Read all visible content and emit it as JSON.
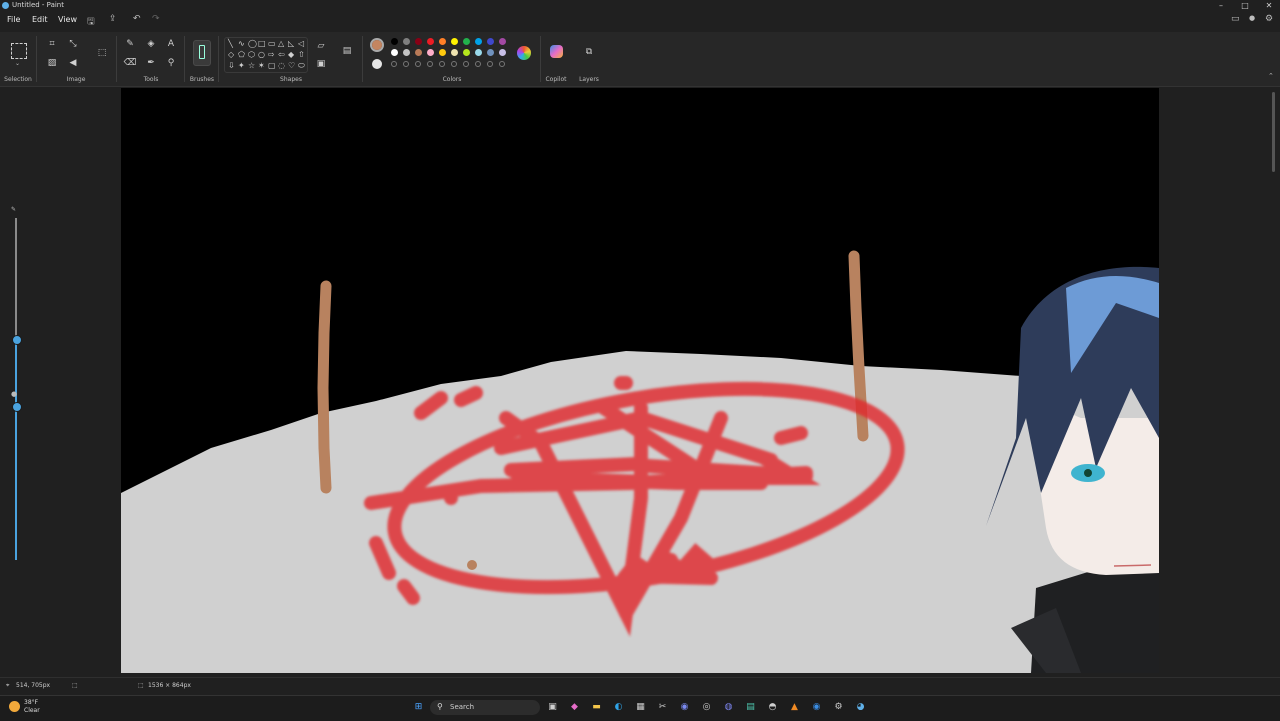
{
  "app": {
    "title": "Untitled - Paint"
  },
  "window_controls": {
    "minimize": "–",
    "maximize": "□",
    "close": "✕"
  },
  "menu": {
    "file": "File",
    "edit": "Edit",
    "view": "View"
  },
  "ribbon": {
    "groups": {
      "selection": "Selection",
      "image": "Image",
      "tools": "Tools",
      "brushes": "Brushes",
      "shapes": "Shapes",
      "colors": "Colors",
      "copilot": "Copilot",
      "layers": "Layers"
    },
    "shape_glyphs": [
      "╲",
      "∿",
      "◯",
      "□",
      "▭",
      "△",
      "◺",
      "◁",
      "◇",
      "⬠",
      "⬡",
      "○",
      "⇨",
      "⇦",
      "◆",
      "⇧",
      "⇩",
      "✦",
      "☆",
      "✶",
      "▢",
      "◌",
      "♡",
      "⬭"
    ],
    "colors": {
      "primary": "#c48560",
      "secondary": "#e6e6e6",
      "row1": [
        "#000000",
        "#7f7f7f",
        "#880015",
        "#ed1c24",
        "#ff7f27",
        "#fff200",
        "#22b14c",
        "#00a2e8",
        "#3f48cc",
        "#a349a4"
      ],
      "row2": [
        "#ffffff",
        "#c3c3c3",
        "#b97a57",
        "#ffaec9",
        "#ffc90e",
        "#efe4b0",
        "#b5e61d",
        "#99d9ea",
        "#7092be",
        "#c8bfe7"
      ]
    }
  },
  "status": {
    "cursor_position": "514, 705px",
    "canvas_size": "1536 × 864px"
  },
  "taskbar": {
    "search_placeholder": "Search",
    "weather_temp": "38°F",
    "weather_desc": "Clear"
  }
}
